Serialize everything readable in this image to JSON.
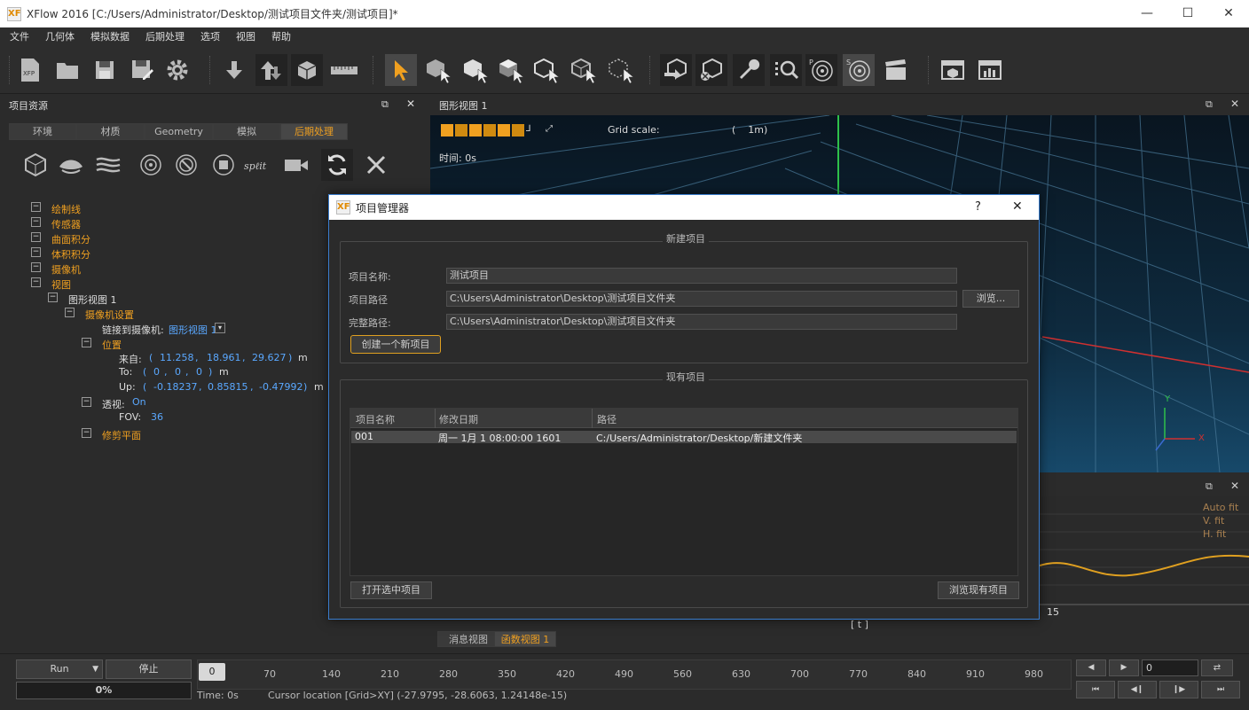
{
  "window": {
    "title": "XFlow 2016 [C:/Users/Administrator/Desktop/测试项目文件夹/测试项目]*",
    "logo": "XF",
    "minimize": "—",
    "maximize": "☐",
    "close": "✕"
  },
  "menu": [
    "文件",
    "几何体",
    "模拟数据",
    "后期处理",
    "选项",
    "视图",
    "帮助"
  ],
  "left_panel": {
    "title": "项目资源",
    "tabs": [
      "环境",
      "材质",
      "Geometry",
      "模拟",
      "后期处理"
    ],
    "active_tab": "后期处理",
    "tree": {
      "items": [
        "绘制线",
        "传感器",
        "曲面积分",
        "体积积分",
        "摄像机",
        "视图"
      ],
      "view_node": "图形视图 1",
      "camera_settings": "摄像机设置",
      "link_camera_label": "链接到摄像机:",
      "link_camera_value": "图形视图 1",
      "position": "位置",
      "from_label": "来自:",
      "from_values": [
        "11.258",
        "18.961",
        "29.627"
      ],
      "to_label": "To:",
      "to_values": [
        "0",
        "0",
        "0"
      ],
      "up_label": "Up:",
      "up_values": [
        "-0.18237",
        "0.85815",
        "-0.47992"
      ],
      "unit": "m",
      "perspective_label": "透视:",
      "perspective_value": "On",
      "fov_label": "FOV:",
      "fov_value": "36",
      "clip_plane": "修剪平面"
    }
  },
  "viewport": {
    "title": "图形视图 1",
    "grid_scale_label": "Grid scale:",
    "grid_scale_value": "(    1m)",
    "time_label": "时间: 0s",
    "axis_y": "Y",
    "axis_x": "X"
  },
  "graph_panel": {
    "auto_fit": "Auto fit",
    "v_fit": "V. fit",
    "h_fit": "H. fit",
    "tick": "15",
    "t_label": "[ t ]"
  },
  "bottom_tabs": [
    "消息视图",
    "函数视图 1"
  ],
  "active_bottom_tab": "函数视图 1",
  "timeline": {
    "run_label": "Run",
    "stop_label": "停止",
    "progress": "0%",
    "current_frame": "0",
    "ticks": [
      "70",
      "140",
      "210",
      "280",
      "350",
      "420",
      "490",
      "560",
      "630",
      "700",
      "770",
      "840",
      "910",
      "980"
    ],
    "time_text": "Time: 0s",
    "cursor_text": "Cursor location [Grid>XY] (-27.9795, -28.6063, 1.24148e-15)",
    "frame_input": "0"
  },
  "dialog": {
    "title": "项目管理器",
    "help": "?",
    "close": "✕",
    "new_project_group": "新建项目",
    "name_label": "项目名称:",
    "name_value": "测试项目",
    "path_label": "项目路径",
    "path_value": "C:\\Users\\Administrator\\Desktop\\测试项目文件夹",
    "browse_label": "浏览...",
    "full_path_label": "完整路径:",
    "full_path_value": "C:\\Users\\Administrator\\Desktop\\测试项目文件夹",
    "create_label": "创建一个新项目",
    "existing_group": "现有项目",
    "columns": [
      "项目名称",
      "修改日期",
      "路径"
    ],
    "rows": [
      {
        "name": "001",
        "date": "周一 1月 1 08:00:00 1601",
        "path": "C:/Users/Administrator/Desktop/新建文件夹"
      }
    ],
    "open_label": "打开选中项目",
    "browse_existing_label": "浏览现有项目"
  },
  "colors": {
    "accent_orange": "#f0a020",
    "value_blue": "#5aa8ff",
    "dialog_border": "#3a7ccc"
  }
}
